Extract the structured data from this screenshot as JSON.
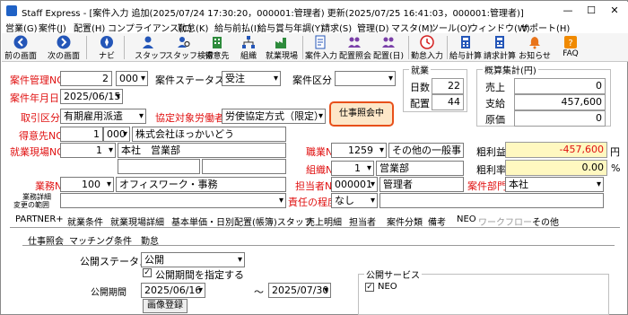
{
  "window": {
    "app_name": "Staff Express",
    "title": "Staff Express - [案件入力 追加(2025/07/24 17:30:20，000001:管理者) 更新(2025/07/25 16:41:03，000001:管理者)]",
    "minimize": "—",
    "maximize": "☐",
    "close": "✕"
  },
  "menu": [
    "営業(G)",
    "案件(J)",
    "配置(H)",
    "コンプライアンス(C)",
    "勤怠(K)",
    "給与前払(I)",
    "給与賞与年調(Y)",
    "請求(S)",
    "管理(D)",
    "マスタ(M)",
    "ツール(O)",
    "ウィンドウ(W)",
    "サポート(H)"
  ],
  "toolbar": {
    "back": "前の画面",
    "forward": "次の画面",
    "nav": "ナビ",
    "staff": "スタッフ",
    "staff_search": "スタッフ検索",
    "client": "得意先",
    "org": "組織",
    "worksite": "就業現場",
    "job_input": "案件入力",
    "placement_inquiry": "配置照会",
    "placement": "配置(日)",
    "attendance": "勤怠入力",
    "payroll_calc": "給与計算",
    "billing_calc": "請求計算",
    "notice": "お知らせ",
    "faq": "FAQ"
  },
  "icon_colors": {
    "blue": "#2456b8",
    "orange": "#e8741a",
    "green": "#2e8b3c",
    "purple": "#7a3fa8",
    "red": "#d42020",
    "faq": "#f08a00"
  },
  "form": {
    "case_mgmt_label": "案件管理NO",
    "case_mgmt_value": "2",
    "case_mgmt_branch": "000",
    "case_status_label": "案件ステータス",
    "case_status_value": "受注",
    "case_category_label": "案件区分",
    "case_category_value": "",
    "case_date_label": "案件年月日",
    "case_date_value": "2025/06/15",
    "transaction_type_label": "取引区分",
    "transaction_type_value": "有期雇用派遣",
    "agreement_label": "協定対象労働者",
    "agreement_value": "労使協定方式（限定）",
    "job_inquiry_button": "仕事照会中",
    "client_no_label": "得意先NO",
    "client_no_value": "1",
    "client_branch": "000",
    "client_name": "株式会社ほっかいどう",
    "worksite_no_label": "就業現場NO",
    "worksite_no_value": "1",
    "worksite_name": "本社　営業部",
    "job_type_no_label": "職業NO",
    "job_type_no_value": "1259",
    "job_type_name": "その他の一般事",
    "org_no_label": "組織NO",
    "org_no_value": "1",
    "org_name": "営業部",
    "duty_no_label": "業務NO",
    "duty_no_value": "100",
    "duty_name": "オフィスワーク・事務",
    "person_no_label": "担当者NO",
    "person_no_value": "000001",
    "person_name": "管理者",
    "case_dept_label": "案件部門",
    "case_dept_value": "本社",
    "duty_detail_label_1": "業務詳細",
    "duty_detail_label_2": "変更の範囲",
    "responsibility_label": "責任の程度",
    "responsibility_value": "なし"
  },
  "days": {
    "header": "就業",
    "days_label": "日数",
    "days_value": "22",
    "placement_label": "配置",
    "placement_value": "44"
  },
  "summary": {
    "header": "概算集計(円)",
    "sales_label": "売上",
    "sales_value": "0",
    "payment_label": "支給",
    "payment_value": "457,600",
    "cost_label": "原価",
    "cost_value": "0",
    "gross_profit_label": "粗利益",
    "gross_profit_value": "-457,600",
    "gross_profit_unit": "円",
    "gross_rate_label": "粗利率",
    "gross_rate_value": "0.00",
    "gross_rate_unit": "%",
    "gross_profit_bg": "#fff8c0",
    "gross_profit_color": "#e01010"
  },
  "tabs": [
    "PARTNER+",
    "就業条件",
    "就業現場詳細",
    "基本単価・日別配置(帳簿)スタッフ",
    "売上明細",
    "担当者",
    "案件分類",
    "備考",
    "NEO",
    "ワークフロー",
    "その他"
  ],
  "subtabs": [
    "仕事照会",
    "マッチング条件",
    "勤怠"
  ],
  "publish": {
    "status_label": "公開ステータス",
    "status_value": "公開",
    "period_checkbox": "公開期間を指定する",
    "period_checked": true,
    "period_label": "公開期間",
    "period_from": "2025/06/16",
    "period_sep": "～",
    "period_to": "2025/07/30",
    "image_button": "画像登録",
    "service_header": "公開サービス",
    "service_neo": "NEO",
    "service_neo_checked": true
  }
}
